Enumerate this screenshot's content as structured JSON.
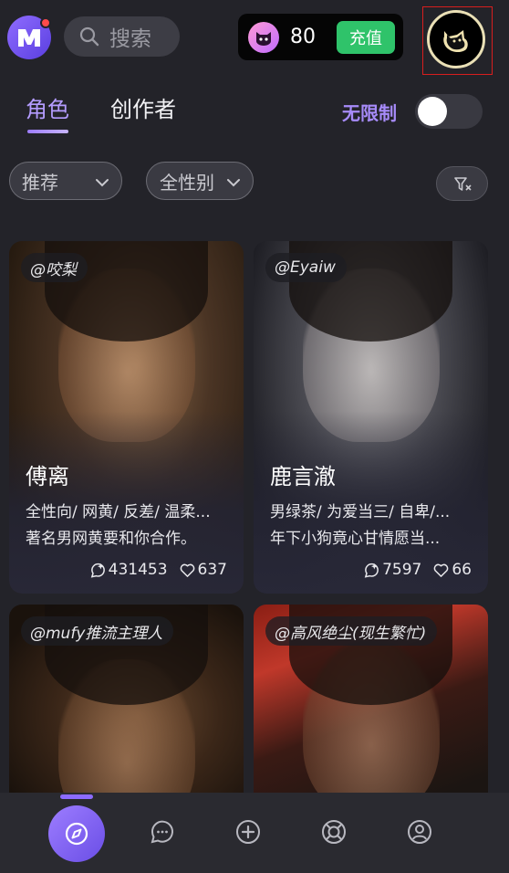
{
  "header": {
    "search_placeholder": "搜索",
    "coin_count": "80",
    "recharge_label": "充值"
  },
  "tabs": [
    {
      "label": "角色",
      "active": true
    },
    {
      "label": "创作者",
      "active": false
    }
  ],
  "unlimited": {
    "label": "无限制",
    "enabled": false
  },
  "filters": {
    "sort": "推荐",
    "gender": "全性别"
  },
  "cards": [
    {
      "author": "@咬梨",
      "name": "傅离",
      "tags": "全性向/ 网黄/ 反差/ 温柔...",
      "description": "著名男网黄要和你合作。",
      "chats": "431453",
      "likes": "637"
    },
    {
      "author": "@Eyaiw",
      "name": "鹿言澈",
      "tags": "男绿茶/ 为爱当三/ 自卑/...",
      "description": "年下小狗竟心甘情愿当...",
      "chats": "7597",
      "likes": "66"
    },
    {
      "author": "@mufy推流主理人"
    },
    {
      "author": "@高风绝尘(现生繁忙)"
    }
  ],
  "nav": [
    "explore",
    "chat",
    "create",
    "community",
    "profile"
  ],
  "colors": {
    "accent": "#a78bfa",
    "background": "#232329",
    "recharge": "#2fc36a"
  }
}
